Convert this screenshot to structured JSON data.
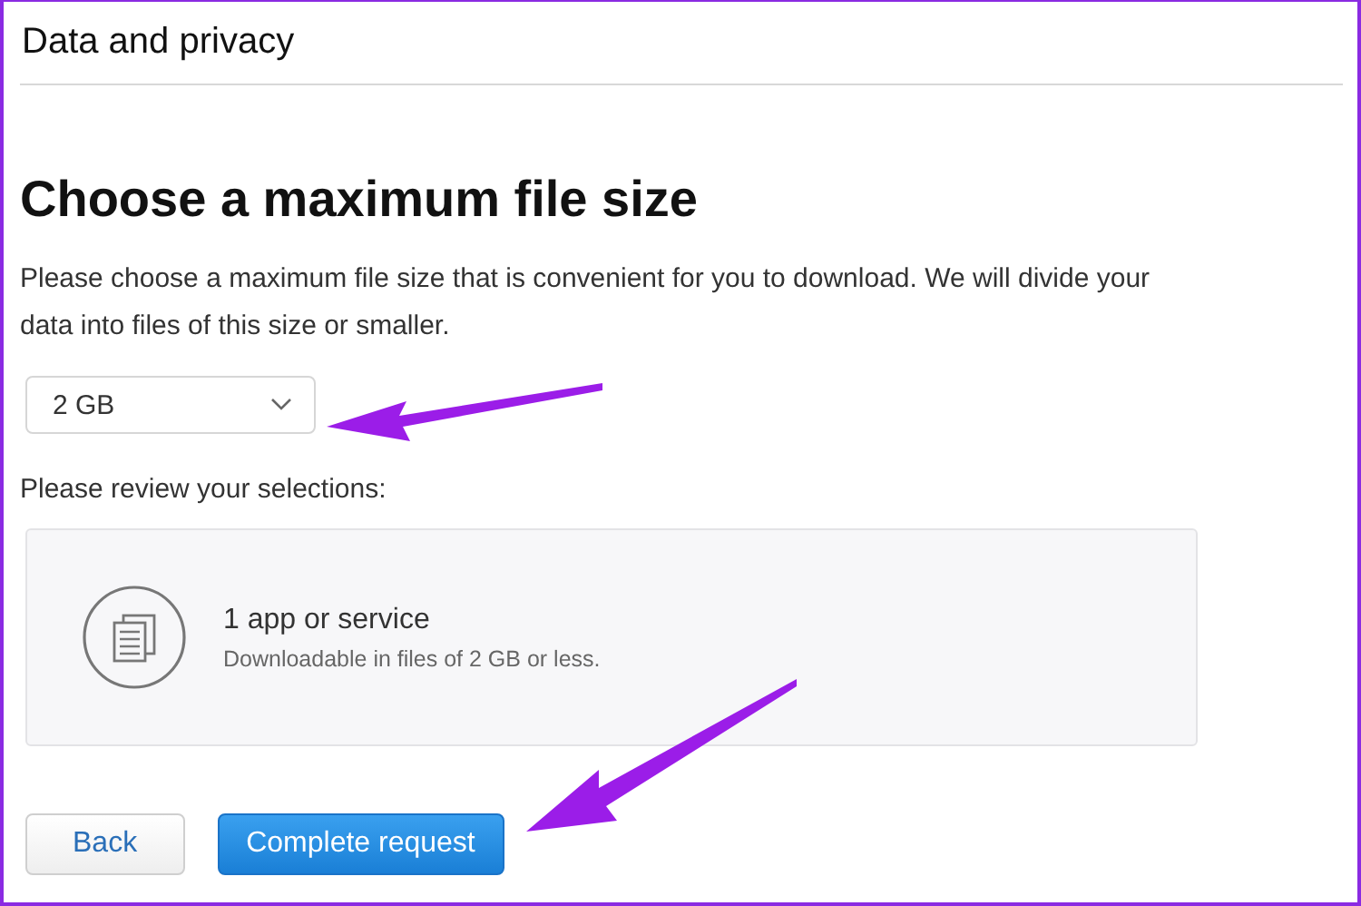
{
  "header": {
    "title": "Data and privacy"
  },
  "heading": "Choose a maximum file size",
  "description": "Please choose a maximum file size that is convenient for you to download. We will divide your data into files of this size or smaller.",
  "file_size_select": {
    "value": "2 GB"
  },
  "review_label": "Please review your selections:",
  "selection": {
    "title": "1 app or service",
    "subtitle": "Downloadable in files of 2 GB or less."
  },
  "buttons": [
    {
      "label": "Back",
      "kind": "secondary"
    },
    {
      "label": "Complete request",
      "kind": "primary"
    }
  ]
}
